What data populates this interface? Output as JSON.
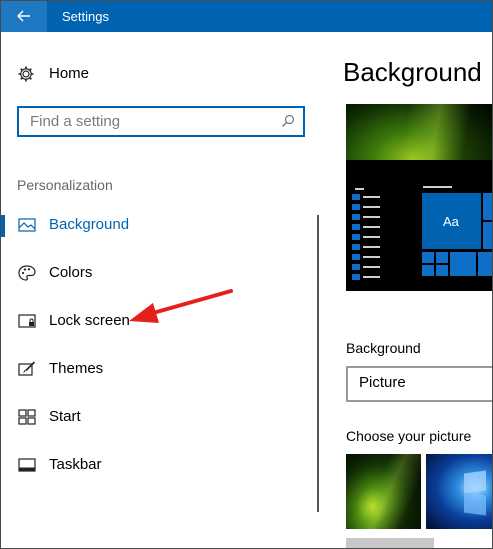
{
  "window": {
    "title": "Settings"
  },
  "sidebar": {
    "home_label": "Home",
    "search_placeholder": "Find a setting",
    "section_label": "Personalization",
    "items": [
      {
        "label": "Background",
        "icon": "picture-icon",
        "selected": true
      },
      {
        "label": "Colors",
        "icon": "palette-icon",
        "selected": false
      },
      {
        "label": "Lock screen",
        "icon": "lock-screen-icon",
        "selected": false
      },
      {
        "label": "Themes",
        "icon": "brush-icon",
        "selected": false
      },
      {
        "label": "Start",
        "icon": "start-grid-icon",
        "selected": false
      },
      {
        "label": "Taskbar",
        "icon": "taskbar-icon",
        "selected": false
      }
    ]
  },
  "main": {
    "page_title": "Background",
    "background_label": "Background",
    "background_value": "Picture",
    "choose_label": "Choose your picture"
  },
  "colors": {
    "accent": "#0063b1",
    "arrow": "#e32119"
  }
}
